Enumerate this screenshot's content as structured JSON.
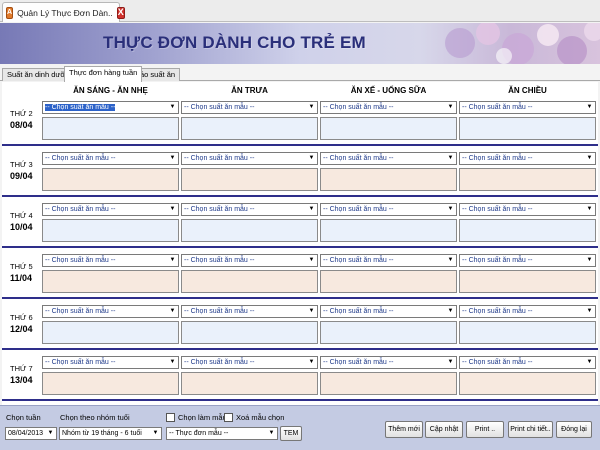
{
  "window": {
    "doc_tab_title": "Quản Lý Thực Đơn Dàn..",
    "app_icon_letter": "A",
    "close_glyph": "X"
  },
  "banner": {
    "title": "THỰC ĐƠN DÀNH CHO TRẺ EM"
  },
  "module_tabs": [
    {
      "label": "Suất ăn dinh dưỡng"
    },
    {
      "label": "Thực đơn hàng tuần"
    },
    {
      "label": "Báo suất ăn"
    }
  ],
  "columns": [
    {
      "label": "ĂN SÁNG - ĂN NHẸ"
    },
    {
      "label": "ĂN TRƯA"
    },
    {
      "label": "ĂN XẾ - UỐNG SỮA"
    },
    {
      "label": "ĂN CHIỀU"
    }
  ],
  "select_placeholder": "-- Chọn suất ăn mẫu --",
  "days": [
    {
      "name": "THỨ 2",
      "date": "08/04",
      "tint": "blue"
    },
    {
      "name": "THỨ 3",
      "date": "09/04",
      "tint": "peach"
    },
    {
      "name": "THỨ 4",
      "date": "10/04",
      "tint": "blue"
    },
    {
      "name": "THỨ 5",
      "date": "11/04",
      "tint": "peach"
    },
    {
      "name": "THỨ 6",
      "date": "12/04",
      "tint": "blue"
    },
    {
      "name": "THỨ 7",
      "date": "13/04",
      "tint": "peach"
    }
  ],
  "footer": {
    "week_label": "Chọn tuần",
    "week_value": "08/04/2013",
    "age_group_label": "Chọn theo nhóm tuổi",
    "age_group_value": "Nhóm từ 19 tháng - 6 tuổi",
    "template_checkbox_label": "Chọn làm mẫu",
    "delete_template_label": "Xoá mẫu chọn",
    "template_menu_value": "-- Thực đơn mẫu --",
    "tem_button": "TEM",
    "add_button": "Thêm mới",
    "update_button": "Cập nhật",
    "print_button": "Print ..",
    "print_detail_button": "Print chi tiết..",
    "close_button": "Đóng lại"
  },
  "colors": {
    "accent_navy": "#2e2e8a",
    "title_color": "#2a2f7a",
    "cell_blue": "#eaf1fb",
    "cell_peach": "#f7e9df",
    "footer_bg": "#c4cbe3"
  }
}
